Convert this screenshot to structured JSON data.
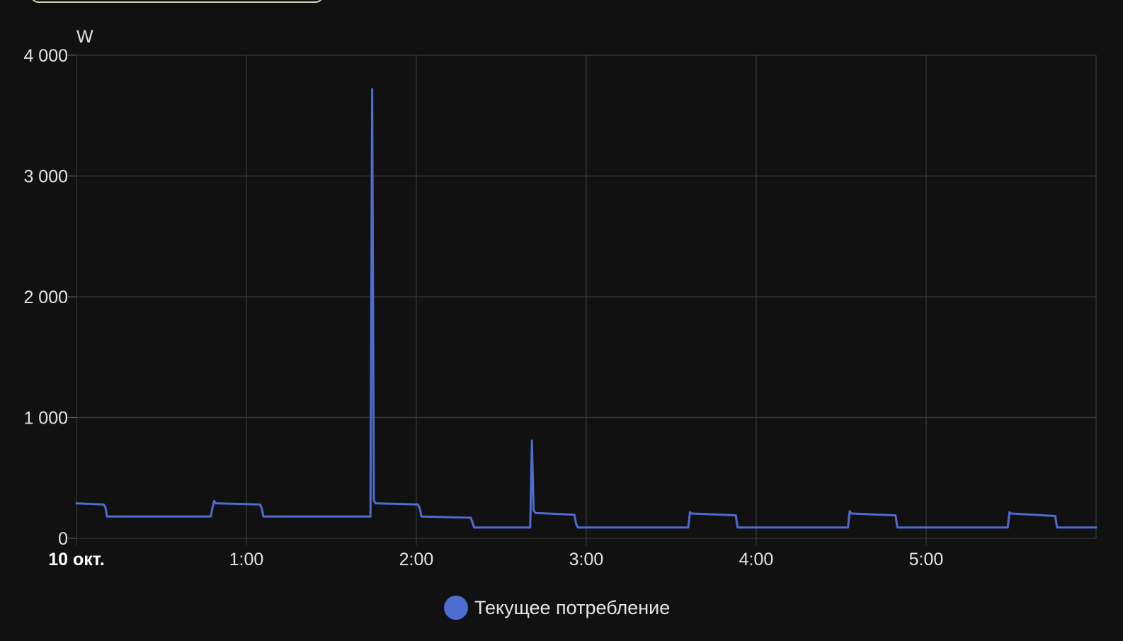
{
  "chart_data": {
    "type": "line",
    "step": true,
    "unit": "W",
    "x_unit": "hours",
    "xlim": [
      0,
      6
    ],
    "ylim": [
      0,
      4000
    ],
    "y_ticks": [
      0,
      1000,
      2000,
      3000,
      4000
    ],
    "y_tick_labels": [
      "0",
      "1 000",
      "2 000",
      "3 000",
      "4 000"
    ],
    "x_ticks": [
      0,
      1,
      2,
      3,
      4,
      5
    ],
    "x_tick_labels": [
      "10 окт.",
      "1:00",
      "2:00",
      "3:00",
      "4:00",
      "5:00"
    ],
    "grid": true,
    "legend_position": "bottom-center",
    "series": [
      {
        "name": "Текущее потребление",
        "color": "#4f6cd0",
        "x": [
          0.0,
          0.16,
          0.17,
          0.18,
          0.79,
          0.8,
          0.81,
          0.82,
          1.08,
          1.09,
          1.1,
          1.73,
          1.74,
          1.75,
          1.76,
          2.01,
          2.02,
          2.03,
          2.32,
          2.33,
          2.34,
          2.67,
          2.68,
          2.69,
          2.7,
          2.93,
          2.94,
          2.95,
          3.6,
          3.61,
          3.62,
          3.88,
          3.89,
          4.54,
          4.55,
          4.56,
          4.82,
          4.83,
          5.48,
          5.49,
          5.5,
          5.76,
          5.77,
          6.0
        ],
        "y": [
          290,
          280,
          260,
          180,
          180,
          250,
          310,
          290,
          280,
          250,
          180,
          180,
          3720,
          310,
          290,
          280,
          250,
          180,
          170,
          130,
          90,
          90,
          810,
          230,
          210,
          195,
          120,
          90,
          90,
          215,
          205,
          190,
          90,
          90,
          225,
          205,
          190,
          90,
          90,
          215,
          205,
          185,
          90,
          90
        ]
      }
    ]
  }
}
